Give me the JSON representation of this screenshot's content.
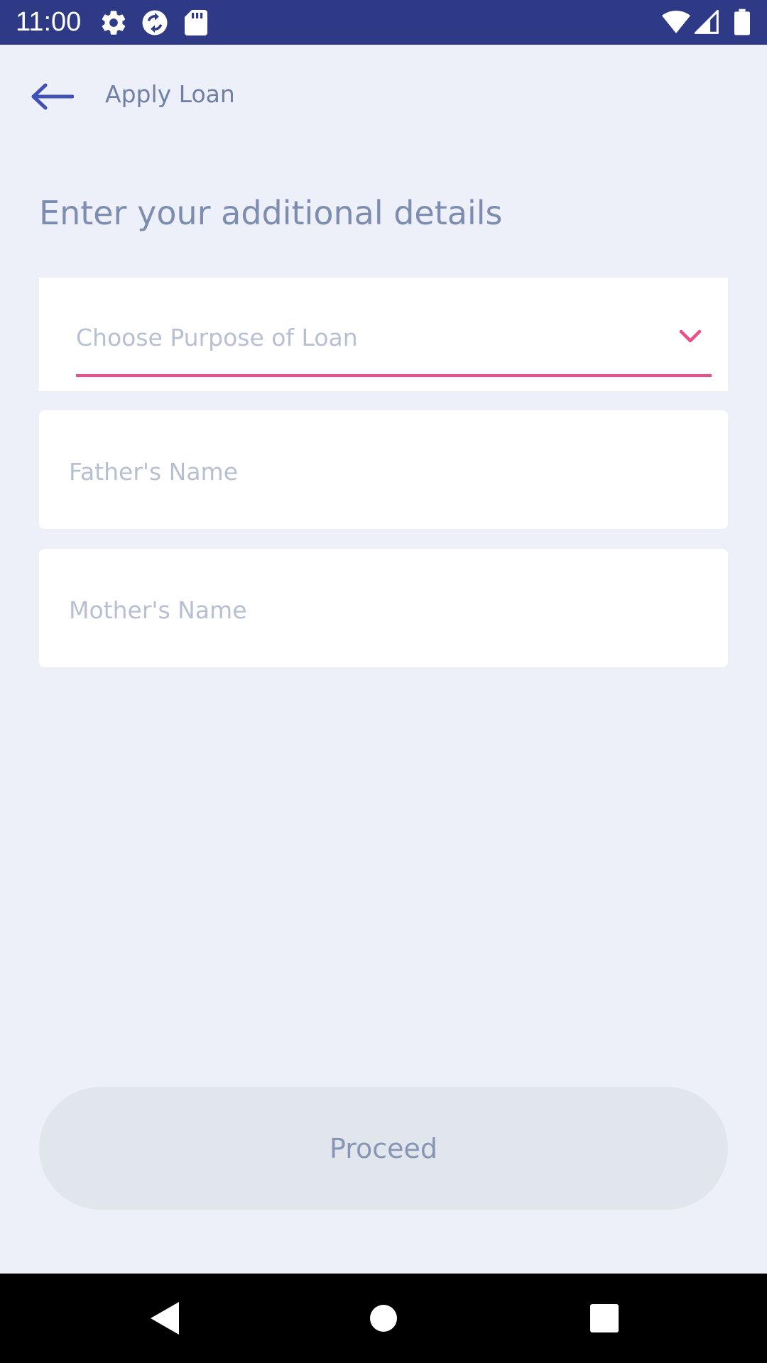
{
  "status_bar": {
    "time": "11:00",
    "left_icons": [
      "settings-icon",
      "sync-icon",
      "sd-card-icon"
    ],
    "right_icons": [
      "wifi-icon",
      "signal-icon",
      "battery-icon"
    ]
  },
  "header": {
    "title": "Apply Loan",
    "back_icon": "arrow-left-icon"
  },
  "form": {
    "heading": "Enter your additional details",
    "purpose_select": {
      "placeholder": "Choose Purpose of Loan",
      "icon": "chevron-down-icon"
    },
    "father_name": {
      "placeholder": "Father's Name",
      "value": ""
    },
    "mother_name": {
      "placeholder": "Mother's Name",
      "value": ""
    },
    "proceed_label": "Proceed"
  },
  "nav_bar": {
    "buttons": [
      "back-icon",
      "home-icon",
      "recents-icon"
    ]
  },
  "colors": {
    "status_bar": "#2f3a86",
    "background": "#edf0f8",
    "accent": "#ee4d8a",
    "back_arrow": "#3f51b5",
    "button_disabled": "#e1e5ec"
  }
}
